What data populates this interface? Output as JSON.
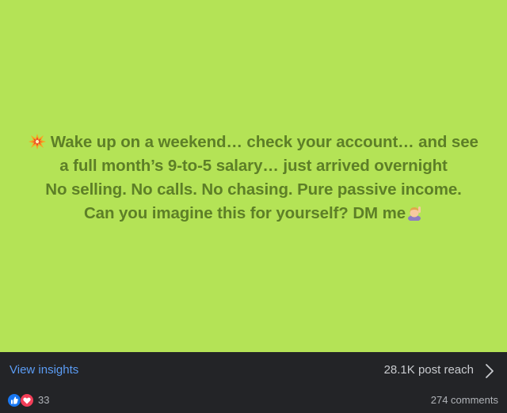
{
  "post": {
    "background_color": "#b4e356",
    "text_color": "#5d7f27",
    "lines": [
      "Wake up on a weekend… check your account… and see",
      "a full month’s 9-to-5 salary… just arrived overnight",
      "No selling. No calls. No chasing. Pure passive income.",
      "Can you imagine this for yourself? DM me"
    ],
    "leading_emoji": "collision-emoji",
    "trailing_emoji": "person-raising-hand-emoji"
  },
  "insights": {
    "link_label": "View insights",
    "reach_label": "28.1K post reach",
    "link_color": "#5b9cf4"
  },
  "reactions": {
    "icons": [
      "like-icon",
      "love-icon"
    ],
    "count": "33",
    "comments_label": "274 comments"
  }
}
